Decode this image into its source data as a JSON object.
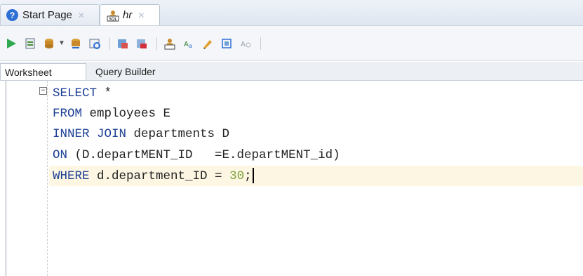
{
  "document_tabs": [
    {
      "label": "Start Page",
      "icon": "help-icon",
      "active": false
    },
    {
      "label": "hr",
      "icon": "sql-connection-icon",
      "active": true
    }
  ],
  "toolbar": {
    "buttons": [
      "run-statement-icon",
      "run-script-icon",
      "commit-icon",
      "rollback-icon",
      "autotrace-icon",
      "explain-plan-icon",
      "sql-tuning-icon",
      "sql-history-icon",
      "clear-icon",
      "format-icon",
      "unshared-sql-icon"
    ]
  },
  "sub_tabs": [
    {
      "label": "Worksheet",
      "selected": true
    },
    {
      "label": "Query Builder",
      "selected": false
    }
  ],
  "editor": {
    "lines": [
      [
        {
          "t": "SELECT",
          "k": "kw"
        },
        {
          "t": " *",
          "k": ""
        }
      ],
      [
        {
          "t": "FROM",
          "k": "kw"
        },
        {
          "t": " employees E",
          "k": ""
        }
      ],
      [
        {
          "t": "INNER JOIN",
          "k": "kw"
        },
        {
          "t": " departments D",
          "k": ""
        }
      ],
      [
        {
          "t": "ON",
          "k": "kw"
        },
        {
          "t": " (D.departMENT_ID   =E.departMENT_id)",
          "k": ""
        }
      ],
      [
        {
          "t": "WHERE",
          "k": "kw"
        },
        {
          "t": " d.department_ID = ",
          "k": ""
        },
        {
          "t": "30",
          "k": "num"
        },
        {
          "t": ";",
          "k": ""
        }
      ]
    ]
  },
  "colors": {
    "keyword": "#1c3f95",
    "number": "#7aa23a",
    "current_line": "#fdf6e3"
  }
}
